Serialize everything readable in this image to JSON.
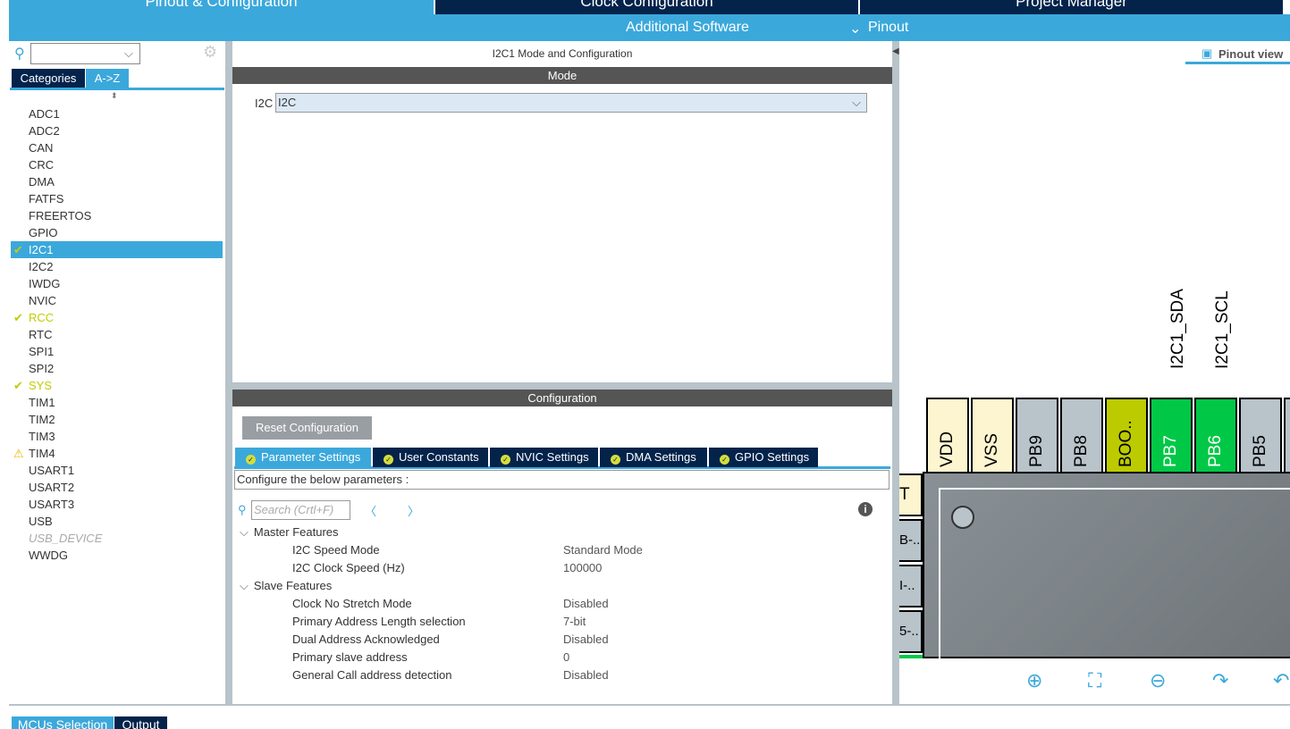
{
  "top_tabs": [
    {
      "label": "Pinout & Configuration",
      "active": true
    },
    {
      "label": "Clock Configuration",
      "active": false
    },
    {
      "label": "Project Manager",
      "active": false
    }
  ],
  "sub_bar": {
    "additional_software": "Additional Software",
    "pinout": "Pinout"
  },
  "left_panel": {
    "search_value": "",
    "tabs": [
      {
        "label": "Categories",
        "active": false
      },
      {
        "label": "A->Z",
        "active": true
      }
    ],
    "items": [
      {
        "label": "ADC1",
        "state": "normal"
      },
      {
        "label": "ADC2",
        "state": "normal"
      },
      {
        "label": "CAN",
        "state": "normal"
      },
      {
        "label": "CRC",
        "state": "normal"
      },
      {
        "label": "DMA",
        "state": "normal"
      },
      {
        "label": "FATFS",
        "state": "normal"
      },
      {
        "label": "FREERTOS",
        "state": "normal"
      },
      {
        "label": "GPIO",
        "state": "normal"
      },
      {
        "label": "I2C1",
        "state": "selected",
        "icon": "check-icon"
      },
      {
        "label": "I2C2",
        "state": "normal"
      },
      {
        "label": "IWDG",
        "state": "normal"
      },
      {
        "label": "NVIC",
        "state": "normal"
      },
      {
        "label": "RCC",
        "state": "ok",
        "icon": "check-icon"
      },
      {
        "label": "RTC",
        "state": "normal"
      },
      {
        "label": "SPI1",
        "state": "normal"
      },
      {
        "label": "SPI2",
        "state": "normal"
      },
      {
        "label": "SYS",
        "state": "ok",
        "icon": "check-icon"
      },
      {
        "label": "TIM1",
        "state": "normal"
      },
      {
        "label": "TIM2",
        "state": "normal"
      },
      {
        "label": "TIM3",
        "state": "normal"
      },
      {
        "label": "TIM4",
        "state": "warning",
        "icon": "warning-icon"
      },
      {
        "label": "USART1",
        "state": "normal"
      },
      {
        "label": "USART2",
        "state": "normal"
      },
      {
        "label": "USART3",
        "state": "normal"
      },
      {
        "label": "USB",
        "state": "normal"
      },
      {
        "label": "USB_DEVICE",
        "state": "disabled"
      },
      {
        "label": "WWDG",
        "state": "normal"
      }
    ]
  },
  "mode_panel": {
    "title": "I2C1 Mode and Configuration",
    "mode_header": "Mode",
    "field_label": "I2C",
    "field_value": "I2C"
  },
  "config_panel": {
    "header": "Configuration",
    "reset_label": "Reset Configuration",
    "tabs": [
      "Parameter Settings",
      "User Constants",
      "NVIC Settings",
      "DMA Settings",
      "GPIO Settings"
    ],
    "description": "Configure the below parameters :",
    "search_placeholder": "Search (Crtl+F)",
    "groups": [
      {
        "name": "Master Features",
        "params": [
          {
            "name": "I2C Speed Mode",
            "value": "Standard Mode"
          },
          {
            "name": "I2C Clock Speed (Hz)",
            "value": "100000"
          }
        ]
      },
      {
        "name": "Slave Features",
        "params": [
          {
            "name": "Clock No Stretch Mode",
            "value": "Disabled"
          },
          {
            "name": "Primary Address Length selection",
            "value": "7-bit"
          },
          {
            "name": "Dual Address Acknowledged",
            "value": "Disabled"
          },
          {
            "name": "Primary slave address",
            "value": "0"
          },
          {
            "name": "General Call address detection",
            "value": "Disabled"
          }
        ]
      }
    ]
  },
  "pinout": {
    "view_label": "Pinout view",
    "signal_labels": [
      "I2C1_SDA",
      "I2C1_SCL"
    ],
    "pins": [
      {
        "label": "VDD",
        "color": "#fdf5cf",
        "text": "#000"
      },
      {
        "label": "VSS",
        "color": "#fdf5cf",
        "text": "#000"
      },
      {
        "label": "PB9",
        "color": "#b8c3ca",
        "text": "#000"
      },
      {
        "label": "PB8",
        "color": "#b8c3ca",
        "text": "#000"
      },
      {
        "label": "BOO..",
        "color": "#bccb00",
        "text": "#000"
      },
      {
        "label": "PB7",
        "color": "#00c846",
        "text": "#fff"
      },
      {
        "label": "PB6",
        "color": "#00c846",
        "text": "#fff"
      },
      {
        "label": "PB5",
        "color": "#b8c3ca",
        "text": "#000"
      },
      {
        "label": "",
        "color": "#b8c3ca",
        "text": "#000"
      }
    ],
    "left_pins": [
      "T",
      "B-..",
      "I-..",
      "5-.."
    ]
  },
  "bottom_tabs": [
    {
      "label": "MCUs Selection",
      "active": true
    },
    {
      "label": "Output",
      "active": false
    }
  ]
}
